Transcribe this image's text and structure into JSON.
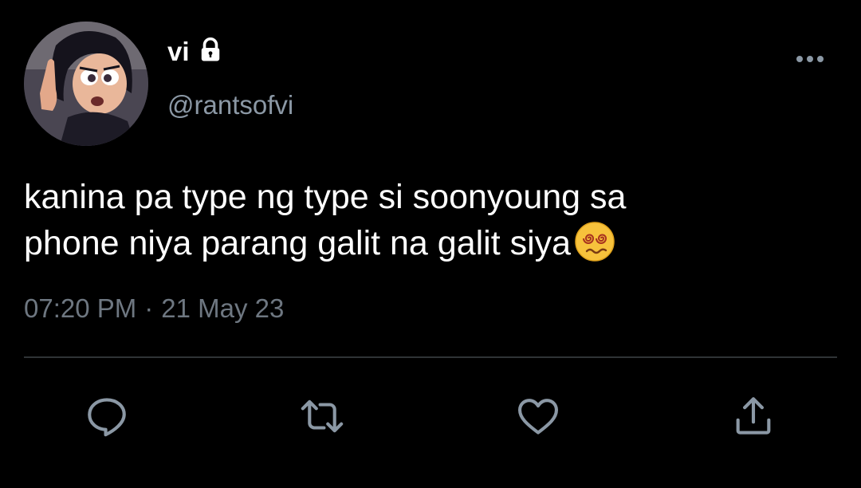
{
  "author": {
    "display_name": "vi",
    "handle": "@rantsofvi",
    "avatar_icon": "cartoon-girl-avatar",
    "protected_icon": "lock-icon"
  },
  "tweet": {
    "lines": [
      "kanina pa type ng type si soonyoung sa",
      "phone niya parang galit na galit siya"
    ],
    "emoji": "dizzy-face-emoji",
    "time": "07:20 PM",
    "separator": "·",
    "date": "21 May 23"
  },
  "actions": {
    "reply_icon": "reply-icon",
    "retweet_icon": "retweet-icon",
    "like_icon": "heart-icon",
    "share_icon": "share-icon",
    "more_icon": "more-options-icon"
  },
  "colors": {
    "background": "#000000",
    "primary_text": "#ffffff",
    "secondary_text": "#8b98a5",
    "icon": "#8b98a5",
    "divider": "#2f3336"
  }
}
